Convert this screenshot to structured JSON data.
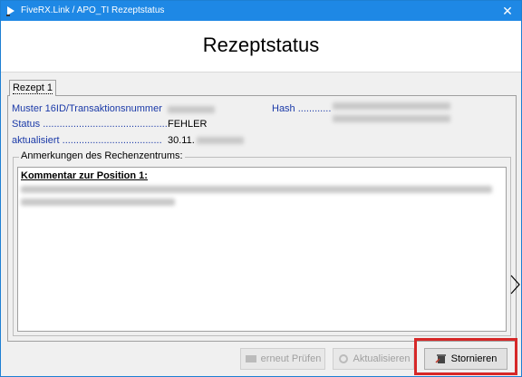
{
  "window": {
    "title": "FiveRX.Link / APO_TI Rezeptstatus",
    "close": "✕"
  },
  "header": {
    "title": "Rezeptstatus"
  },
  "tabs": [
    {
      "label": "Rezept 1"
    }
  ],
  "fields": {
    "muster_label": "Muster 16ID/Transaktionsnummer",
    "hash_label": "Hash ............",
    "status_label": "Status .............................................",
    "status_value": "FEHLER",
    "aktualisiert_label": "aktualisiert ....................................",
    "aktualisiert_value": "30.11."
  },
  "remarks": {
    "group_label": "Anmerkungen des Rechenzentrums:",
    "comment_heading": "Kommentar zur Position 1:"
  },
  "buttons": {
    "pruefen": "erneut Prüfen",
    "aktualisieren": "Aktualisieren",
    "stornieren": "Stornieren"
  },
  "colors": {
    "titlebar": "#1e88e5",
    "label": "#1b3aa8",
    "highlight": "#d62828"
  }
}
